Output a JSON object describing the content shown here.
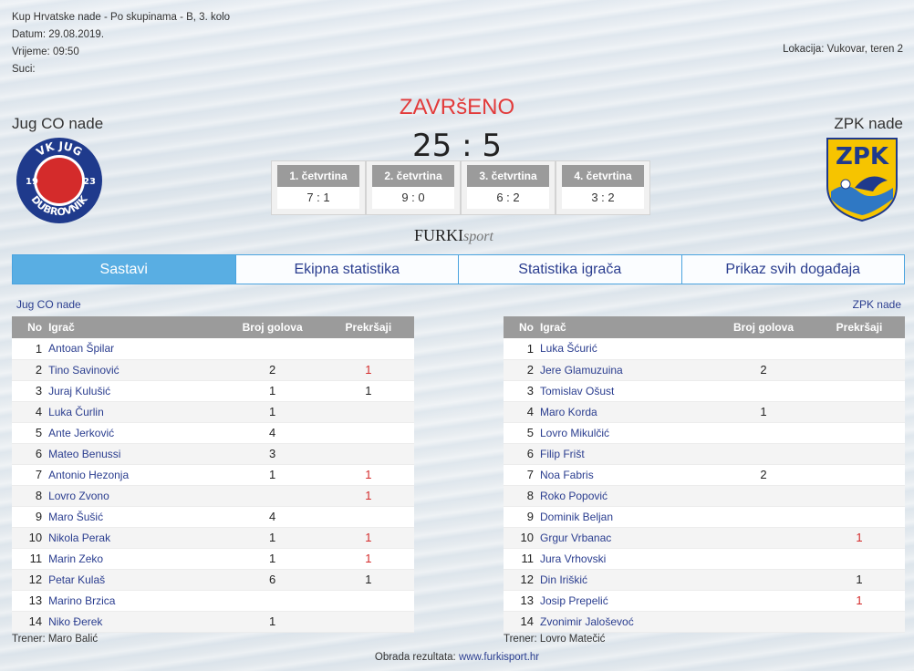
{
  "match": {
    "competition": "Kup Hrvatske nade - Po skupinama - B, 3. kolo",
    "date": "Datum: 29.08.2019.",
    "time": "Vrijeme: 09:50",
    "referees": "Suci:",
    "location": "Lokacija: Vukovar, teren 2",
    "status": "ZAVRšENO",
    "score": "25 : 5"
  },
  "home": {
    "name": "Jug CO nade",
    "logo_text_top": "VK JUG",
    "logo_text_bottom": "DUBROVNIK",
    "logo_year_left": "19",
    "logo_year_right": "23",
    "coach": "Trener: Maro Balić"
  },
  "away": {
    "name": "ZPK nade",
    "logo_text": "ZPK",
    "coach": "Trener: Lovro Matečić"
  },
  "quarters": [
    {
      "label": "1. četvrtina",
      "score": "7 : 1"
    },
    {
      "label": "2. četvrtina",
      "score": "9 : 0"
    },
    {
      "label": "3. četvrtina",
      "score": "6 : 2"
    },
    {
      "label": "4. četvrtina",
      "score": "3 : 2"
    }
  ],
  "brand": {
    "main": "FURKI",
    "sub": "sport"
  },
  "tabs": [
    "Sastavi",
    "Ekipna statistika",
    "Statistika igrača",
    "Prikaz svih događaja"
  ],
  "table_headers": {
    "no": "No",
    "player": "Igrač",
    "goals": "Broj golova",
    "fouls": "Prekršaji"
  },
  "home_roster": [
    {
      "no": "1",
      "name": "Antoan Špilar",
      "goals": "",
      "fouls": ""
    },
    {
      "no": "2",
      "name": "Tino Savinović",
      "goals": "2",
      "fouls": "1"
    },
    {
      "no": "3",
      "name": "Juraj Kulušić",
      "goals": "1",
      "fouls": "1"
    },
    {
      "no": "4",
      "name": "Luka Čurlin",
      "goals": "1",
      "fouls": ""
    },
    {
      "no": "5",
      "name": "Ante Jerković",
      "goals": "4",
      "fouls": ""
    },
    {
      "no": "6",
      "name": "Mateo Benussi",
      "goals": "3",
      "fouls": ""
    },
    {
      "no": "7",
      "name": "Antonio Hezonja",
      "goals": "1",
      "fouls": "1"
    },
    {
      "no": "8",
      "name": "Lovro Zvono",
      "goals": "",
      "fouls": "1"
    },
    {
      "no": "9",
      "name": "Maro Šušić",
      "goals": "4",
      "fouls": ""
    },
    {
      "no": "10",
      "name": "Nikola Perak",
      "goals": "1",
      "fouls": "1"
    },
    {
      "no": "11",
      "name": "Marin Zeko",
      "goals": "1",
      "fouls": "1"
    },
    {
      "no": "12",
      "name": "Petar Kulaš",
      "goals": "6",
      "fouls": "1"
    },
    {
      "no": "13",
      "name": "Marino Brzica",
      "goals": "",
      "fouls": ""
    },
    {
      "no": "14",
      "name": "Niko Đerek",
      "goals": "1",
      "fouls": ""
    }
  ],
  "away_roster": [
    {
      "no": "1",
      "name": "Luka Šćurić",
      "goals": "",
      "fouls": ""
    },
    {
      "no": "2",
      "name": "Jere Glamuzuina",
      "goals": "2",
      "fouls": ""
    },
    {
      "no": "3",
      "name": "Tomislav Ošust",
      "goals": "",
      "fouls": ""
    },
    {
      "no": "4",
      "name": "Maro Korda",
      "goals": "1",
      "fouls": ""
    },
    {
      "no": "5",
      "name": "Lovro Mikulčić",
      "goals": "",
      "fouls": ""
    },
    {
      "no": "6",
      "name": "Filip Frišt",
      "goals": "",
      "fouls": ""
    },
    {
      "no": "7",
      "name": "Noa Fabris",
      "goals": "2",
      "fouls": ""
    },
    {
      "no": "8",
      "name": "Roko Popović",
      "goals": "",
      "fouls": ""
    },
    {
      "no": "9",
      "name": "Dominik Beljan",
      "goals": "",
      "fouls": ""
    },
    {
      "no": "10",
      "name": "Grgur Vrbanac",
      "goals": "",
      "fouls": "1"
    },
    {
      "no": "11",
      "name": "Jura Vrhovski",
      "goals": "",
      "fouls": ""
    },
    {
      "no": "12",
      "name": "Din Iriškić",
      "goals": "",
      "fouls": "1"
    },
    {
      "no": "13",
      "name": "Josip Prepelić",
      "goals": "",
      "fouls": "1"
    },
    {
      "no": "14",
      "name": "Zvonimir Jaloševoć",
      "goals": "",
      "fouls": ""
    }
  ],
  "foul_colors": {
    "home": [
      "",
      "red",
      "black",
      "",
      "",
      "",
      "red",
      "red",
      "",
      "red",
      "red",
      "black",
      "",
      ""
    ],
    "away": [
      "",
      "",
      "",
      "",
      "",
      "",
      "",
      "",
      "",
      "red",
      "",
      "black",
      "red",
      ""
    ]
  },
  "footer": {
    "label": "Obrada rezultata:",
    "link": "www.furkisport.hr"
  },
  "colors": {
    "accent": "#59aee3",
    "status": "#e23b3b",
    "link": "#2a3d8f",
    "header": "#9b9b9b"
  }
}
